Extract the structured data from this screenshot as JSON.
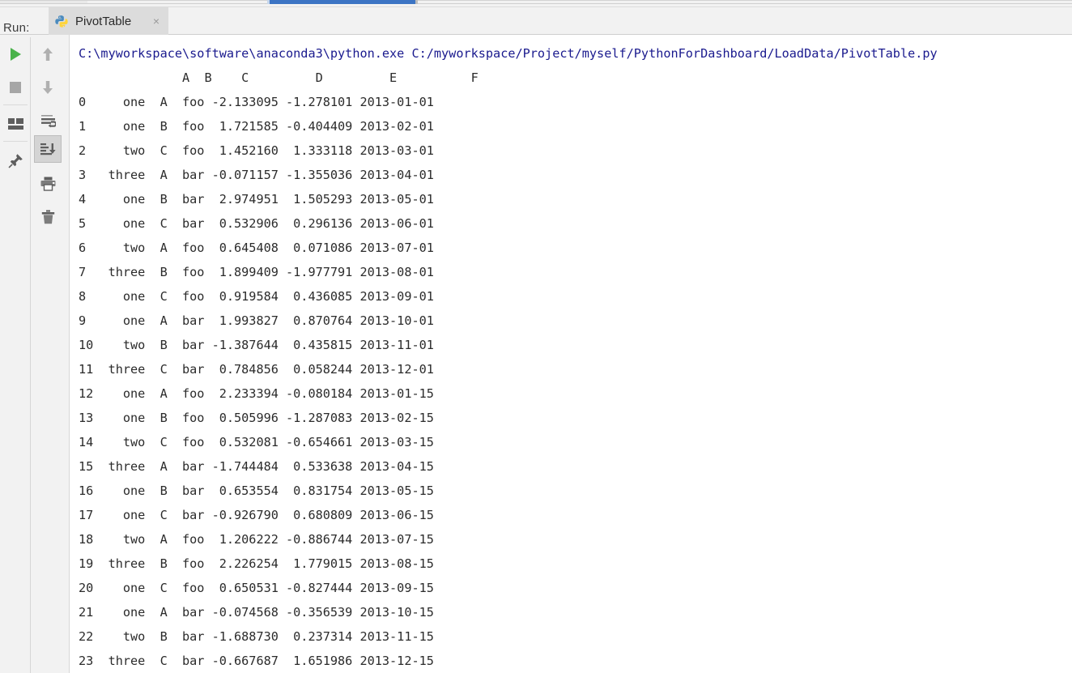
{
  "window": {
    "accent_color": "#3c74c4",
    "toolwindow_label": "Run:",
    "tab": {
      "title": "PivotTable",
      "icon": "python-file-icon",
      "close_label": "×"
    }
  },
  "toolbar": {
    "left_column": [
      {
        "name": "rerun-button",
        "icon": "play-icon",
        "selected": false
      },
      {
        "name": "stop-button",
        "icon": "stop-square-icon",
        "selected": false
      },
      {
        "name": "layout-settings-button",
        "icon": "layout-icon",
        "selected": false
      },
      {
        "name": "pin-tab-button",
        "icon": "pin-icon",
        "selected": false
      }
    ],
    "right_column": [
      {
        "name": "up-the-stack-trace-button",
        "icon": "arrow-up-icon",
        "selected": false
      },
      {
        "name": "down-the-stack-trace-button",
        "icon": "arrow-down-icon",
        "selected": false
      },
      {
        "name": "soft-wrap-button",
        "icon": "soft-wrap-icon",
        "selected": false
      },
      {
        "name": "scroll-to-end-button",
        "icon": "scroll-to-end-icon",
        "selected": true
      },
      {
        "name": "print-button",
        "icon": "printer-icon",
        "selected": false
      },
      {
        "name": "clear-all-button",
        "icon": "trash-icon",
        "selected": false
      }
    ]
  },
  "console": {
    "command_line": "C:\\myworkspace\\software\\anaconda3\\python.exe C:/myworkspace/Project/myself/PythonForDashboard/LoadData/PivotTable.py",
    "command_color": "#1a1a8e",
    "output_color": "#2b2b2b",
    "dataframe_text": "              A  B    C         D         E          F\n0     one  A  foo -2.133095 -1.278101 2013-01-01\n1     one  B  foo  1.721585 -0.404409 2013-02-01\n2     two  C  foo  1.452160  1.333118 2013-03-01\n3   three  A  bar -0.071157 -1.355036 2013-04-01\n4     one  B  bar  2.974951  1.505293 2013-05-01\n5     one  C  bar  0.532906  0.296136 2013-06-01\n6     two  A  foo  0.645408  0.071086 2013-07-01\n7   three  B  foo  1.899409 -1.977791 2013-08-01\n8     one  C  foo  0.919584  0.436085 2013-09-01\n9     one  A  bar  1.993827  0.870764 2013-10-01\n10    two  B  bar -1.387644  0.435815 2013-11-01\n11  three  C  bar  0.784856  0.058244 2013-12-01\n12    one  A  foo  2.233394 -0.080184 2013-01-15\n13    one  B  foo  0.505996 -1.287083 2013-02-15\n14    two  C  foo  0.532081 -0.654661 2013-03-15\n15  three  A  bar -1.744484  0.533638 2013-04-15\n16    one  B  bar  0.653554  0.831754 2013-05-15\n17    one  C  bar -0.926790  0.680809 2013-06-15\n18    two  A  foo  1.206222 -0.886744 2013-07-15\n19  three  B  foo  2.226254  1.779015 2013-08-15\n20    one  C  foo  0.650531 -0.827444 2013-09-15\n21    one  A  bar -0.074568 -0.356539 2013-10-15\n22    two  B  bar -1.688730  0.237314 2013-11-15\n23  three  C  bar -0.667687  1.651986 2013-12-15",
    "table": {
      "columns": [
        "",
        "A",
        "B",
        "C",
        "D",
        "E",
        "F"
      ],
      "rows": [
        [
          "0",
          "one",
          "A",
          "foo",
          "-2.133095",
          "-1.278101",
          "2013-01-01"
        ],
        [
          "1",
          "one",
          "B",
          "foo",
          "1.721585",
          "-0.404409",
          "2013-02-01"
        ],
        [
          "2",
          "two",
          "C",
          "foo",
          "1.452160",
          "1.333118",
          "2013-03-01"
        ],
        [
          "3",
          "three",
          "A",
          "bar",
          "-0.071157",
          "-1.355036",
          "2013-04-01"
        ],
        [
          "4",
          "one",
          "B",
          "bar",
          "2.974951",
          "1.505293",
          "2013-05-01"
        ],
        [
          "5",
          "one",
          "C",
          "bar",
          "0.532906",
          "0.296136",
          "2013-06-01"
        ],
        [
          "6",
          "two",
          "A",
          "foo",
          "0.645408",
          "0.071086",
          "2013-07-01"
        ],
        [
          "7",
          "three",
          "B",
          "foo",
          "1.899409",
          "-1.977791",
          "2013-08-01"
        ],
        [
          "8",
          "one",
          "C",
          "foo",
          "0.919584",
          "0.436085",
          "2013-09-01"
        ],
        [
          "9",
          "one",
          "A",
          "bar",
          "1.993827",
          "0.870764",
          "2013-10-01"
        ],
        [
          "10",
          "two",
          "B",
          "bar",
          "-1.387644",
          "0.435815",
          "2013-11-01"
        ],
        [
          "11",
          "three",
          "C",
          "bar",
          "0.784856",
          "0.058244",
          "2013-12-01"
        ],
        [
          "12",
          "one",
          "A",
          "foo",
          "2.233394",
          "-0.080184",
          "2013-01-15"
        ],
        [
          "13",
          "one",
          "B",
          "foo",
          "0.505996",
          "-1.287083",
          "2013-02-15"
        ],
        [
          "14",
          "two",
          "C",
          "foo",
          "0.532081",
          "-0.654661",
          "2013-03-15"
        ],
        [
          "15",
          "three",
          "A",
          "bar",
          "-1.744484",
          "0.533638",
          "2013-04-15"
        ],
        [
          "16",
          "one",
          "B",
          "bar",
          "0.653554",
          "0.831754",
          "2013-05-15"
        ],
        [
          "17",
          "one",
          "C",
          "bar",
          "-0.926790",
          "0.680809",
          "2013-06-15"
        ],
        [
          "18",
          "two",
          "A",
          "foo",
          "1.206222",
          "-0.886744",
          "2013-07-15"
        ],
        [
          "19",
          "three",
          "B",
          "foo",
          "2.226254",
          "1.779015",
          "2013-08-15"
        ],
        [
          "20",
          "one",
          "C",
          "foo",
          "0.650531",
          "-0.827444",
          "2013-09-15"
        ],
        [
          "21",
          "one",
          "A",
          "bar",
          "-0.074568",
          "-0.356539",
          "2013-10-15"
        ],
        [
          "22",
          "two",
          "B",
          "bar",
          "-1.688730",
          "0.237314",
          "2013-11-15"
        ],
        [
          "23",
          "three",
          "C",
          "bar",
          "-0.667687",
          "1.651986",
          "2013-12-15"
        ]
      ]
    }
  }
}
